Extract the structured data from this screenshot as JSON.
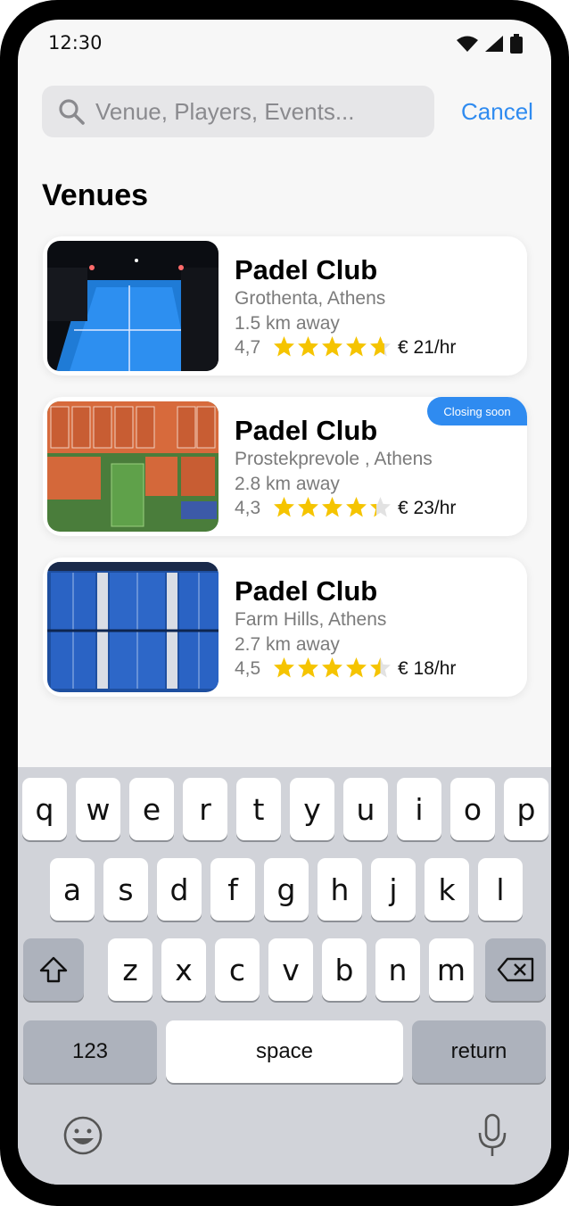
{
  "status_bar": {
    "time": "12:30"
  },
  "search": {
    "placeholder": "Venue, Players, Events...",
    "cancel_label": "Cancel"
  },
  "section_title": "Venues",
  "venues": [
    {
      "name": "Padel Club",
      "location": "Grothenta, Athens",
      "distance": "1.5 km away",
      "rating": "4,7",
      "rating_value": 4.7,
      "price": "€ 21/hr",
      "badge": ""
    },
    {
      "name": "Padel Club",
      "location": "Prostekprevole , Athens",
      "distance": "2.8 km away",
      "rating": "4,3",
      "rating_value": 4.3,
      "price": "€ 23/hr",
      "badge": "Closing soon"
    },
    {
      "name": "Padel Club",
      "location": "Farm Hills, Athens",
      "distance": "2.7 km away",
      "rating": "4,5",
      "rating_value": 4.5,
      "price": "€ 18/hr",
      "badge": ""
    }
  ],
  "keyboard": {
    "row1": [
      "q",
      "w",
      "e",
      "r",
      "t",
      "y",
      "u",
      "i",
      "o",
      "p"
    ],
    "row2": [
      "a",
      "s",
      "d",
      "f",
      "g",
      "h",
      "j",
      "k",
      "l"
    ],
    "row3": [
      "z",
      "x",
      "c",
      "v",
      "b",
      "n",
      "m"
    ],
    "numbers_label": "123",
    "space_label": "space",
    "return_label": "return"
  },
  "colors": {
    "accent": "#2f8bf0",
    "star": "#f5c400",
    "star_empty": "#e2e2e2"
  }
}
